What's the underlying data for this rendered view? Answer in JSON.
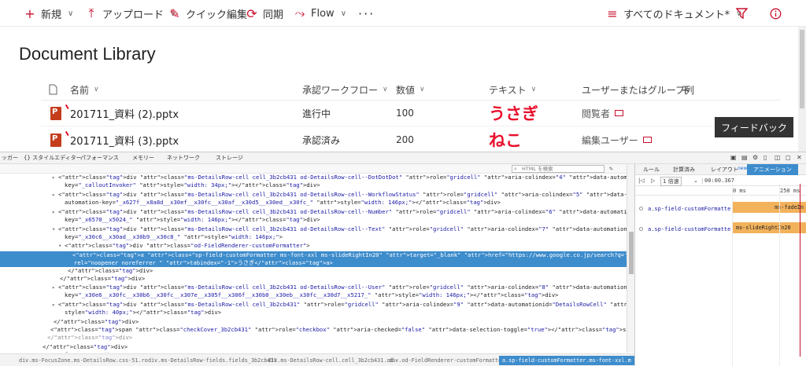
{
  "commandbar": {
    "new_label": "新規",
    "upload_label": "アップロード",
    "quickedit_label": "クイック編集",
    "sync_label": "同期",
    "flow_label": "Flow",
    "more_label": "···",
    "view_label": "すべてのドキュメント*"
  },
  "library": {
    "title": "Document Library",
    "columns": {
      "name": "名前",
      "workflow": "承認ワークフロー",
      "number": "数値",
      "text": "テキスト",
      "user": "ユーザーまたはグループ列",
      "add": "+"
    },
    "rows": [
      {
        "name": "201711_資料 (2).pptx",
        "workflow": "進行中",
        "number": "100",
        "text": "うさぎ",
        "user": "閲覧者"
      },
      {
        "name": "201711_資料 (3).pptx",
        "workflow": "承認済み",
        "number": "200",
        "text": "ねこ",
        "user": "編集ユーザー"
      }
    ],
    "feedback_label": "フィードバック"
  },
  "devtools": {
    "tabs": [
      "ッガー",
      "{} スタイルエディター",
      "パフォーマンス",
      "メモリー",
      "ネットワーク",
      "ストレージ"
    ],
    "search_placeholder": "HTML を検索",
    "dom_lines": [
      "<div class=\"ms-DetailsRow-cell cell_3b2cb431 od-DetailsRow-cell--DotDotDot\" role=\"gridcell\" aria-colindex=\"4\" data-automationid=\"DetailsRowCell\" data-automation-",
      "key=\"_calloutInvoker\" style=\"width: 34px;\"></div>",
      "<div class=\"ms-DetailsRow-cell cell_3b2cb431 od-DetailsRow-cell--WorkflowStatus\" role=\"gridcell\" aria-colindex=\"5\" data-automationid=\"DetailsRowCell\" data-",
      "automation-key=\"_x627f__x8a8d__x30ef__x30fc__x30af__x30d5__x30ed__x30fc_\" style=\"width: 146px;\"></div>",
      "<div class=\"ms-DetailsRow-cell cell_3b2cb431 od-DetailsRow-cell--Number\" role=\"gridcell\" aria-colindex=\"6\" data-automationid=\"DetailsRowCell\" data-automation-",
      "key=\"_x6570__x5024_\" style=\"width: 146px;\"></div>",
      "<div class=\"ms-DetailsRow-cell cell_3b2cb431 od-DetailsRow-cell--Text\" role=\"gridcell\" aria-colindex=\"7\" data-automationid=\"DetailsRowCell\" data-automation-",
      "key=\"_x30c6__x30ad__x30b9__x30c8_\" style=\"width: 146px;\">",
      "<div class=\"od-FieldRenderer-customFormatter\">",
      "<a class=\"sp-field-customFormatter ms-font-xxl ms-slideRightIn20\" target=\"_blank\" href=\"https://www.google.co.jp/search?q=うさぎ&source=lnms&tbm=isch\"",
      "rel=\"noopener noreferrer \" tabindex=\"-1\">うさぎ</a>",
      "</div>",
      "</div>",
      "<div class=\"ms-DetailsRow-cell cell_3b2cb431 od-DetailsRow-cell--User\" role=\"gridcell\" aria-colindex=\"8\" data-automationid=\"DetailsRowCell\" data-automation-",
      "key=\"_x30e6__x30fc__x30b6__x30fc__x307e__x305f__x306f__x30b0__x30eb__x30fc__x30d7__x5217_\" style=\"width: 146px;\"></div>",
      "<div class=\"ms-DetailsRow-cell cell_3b2cb431\" role=\"gridcell\" aria-colindex=\"9\" data-automationid=\"DetailsRowCell\" data-automation-key=\"__newColumnHeaderCommand\"",
      "style=\"width: 40px;\"></div>",
      "</div>",
      "<span class=\"checkCover_3b2cb431\" role=\"checkbox\" aria-checked=\"false\" data-selection-toggle=\"true\"></span>",
      "</div>",
      "</div>",
      "</div>"
    ],
    "breadcrumbs": [
      "div.ms-FocusZone.ms-DetailsRow.css-51.ro",
      "div.ms-DetailsRow-fields.fields_3b2cb431",
      "div.ms-DetailsRow-cell.cell_3b2cb431.od-",
      "div.od-FieldRenderer-customFormatter",
      "a.sp-field-customFormatter.ms-font-xxl.m"
    ],
    "side_tabs": [
      "ルール",
      "計算済み",
      "レイアウト",
      "new!",
      "アニメーション"
    ],
    "anim_speed": "1 倍速",
    "anim_time": "00:00.367",
    "timeline_start": "0 ms",
    "timeline_end": "250 ms",
    "animations": [
      {
        "target": "a.sp-field-customFormatte",
        "name": "ms-fadeIn"
      },
      {
        "target": "a.sp-field-customFormatte",
        "name": "ms-slideRightIn20"
      }
    ]
  }
}
